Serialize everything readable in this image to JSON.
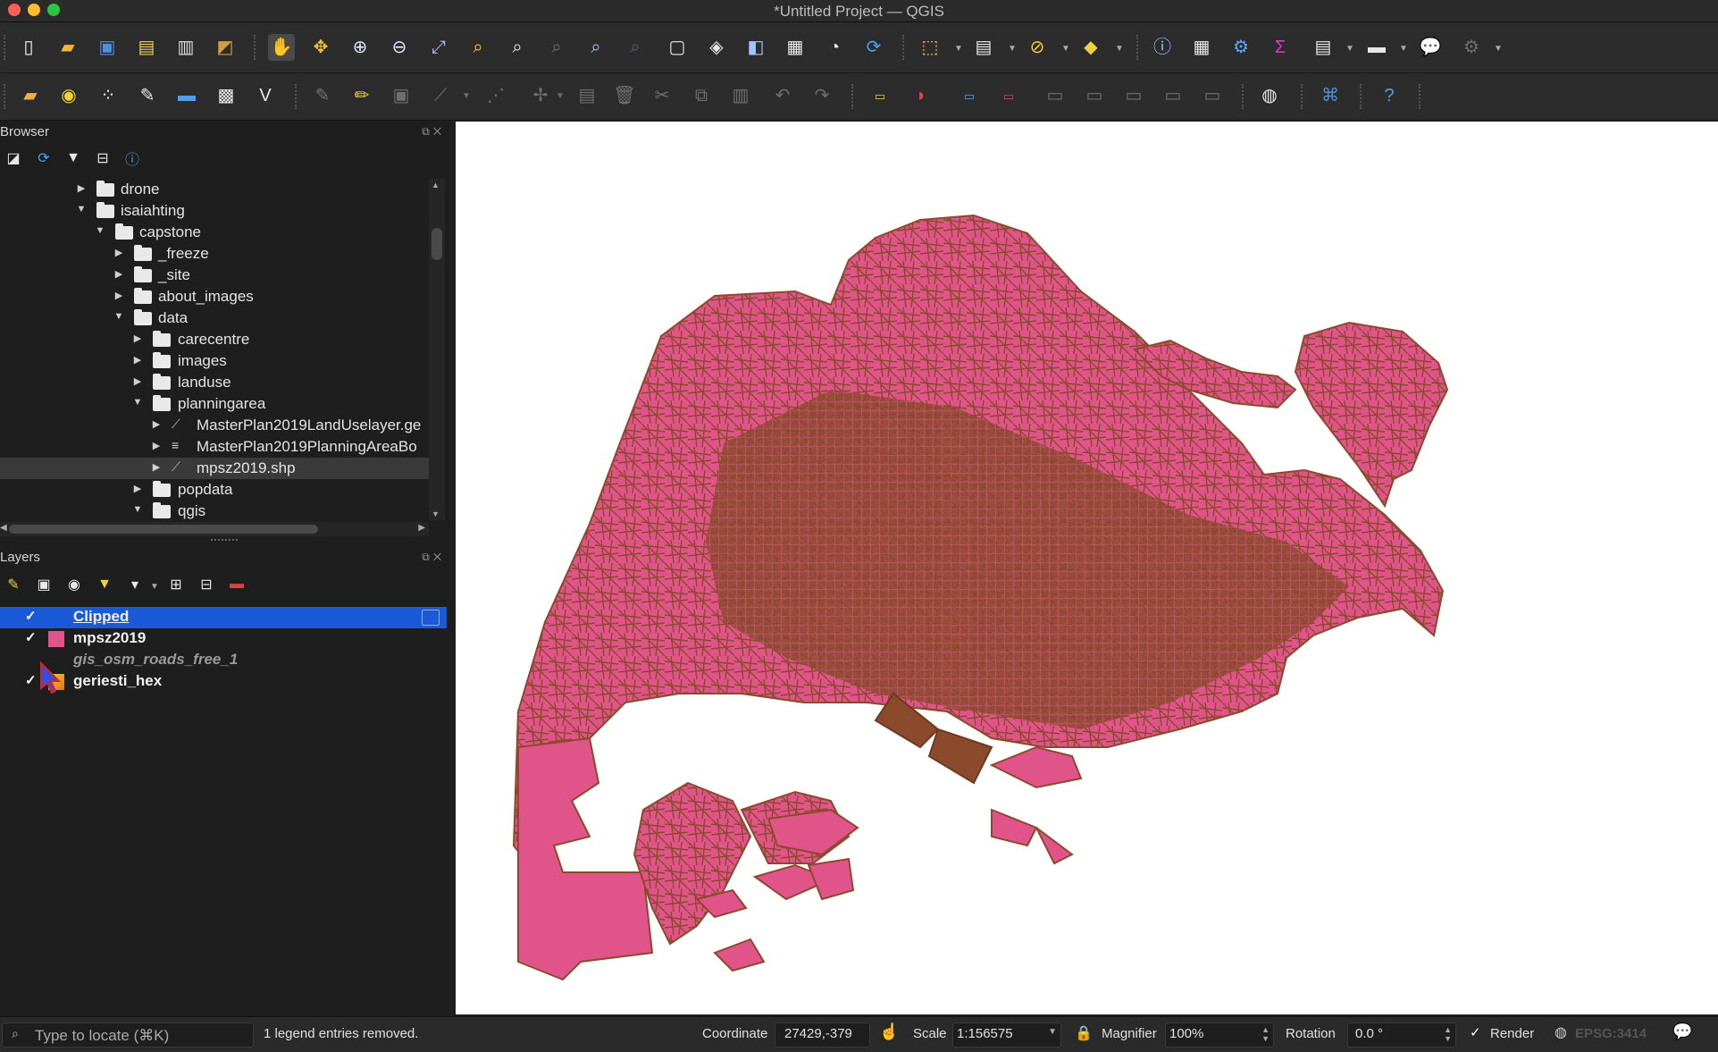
{
  "window": {
    "title": "*Untitled Project — QGIS"
  },
  "toolbar_icons_row1": [
    "new-project",
    "open-project",
    "save-project",
    "new-print-layout",
    "layout-manager",
    "style-manager",
    "pan",
    "pan-to-selection",
    "zoom-in",
    "zoom-out",
    "zoom-full",
    "zoom-to-selection",
    "zoom-to-layer",
    "zoom-native",
    "zoom-last",
    "zoom-next",
    "new-map-view",
    "new-3d-view",
    "new-bookmark",
    "show-bookmarks",
    "temporal-controller",
    "refresh",
    "select-features",
    "select-by-value",
    "deselect",
    "select-by-location",
    "identify",
    "attribute-table",
    "processing",
    "statistics",
    "open-table",
    "measure",
    "map-tips",
    "browse-tools"
  ],
  "toolbar_icons_row2": [
    "data-source-manager",
    "new-geopackage",
    "new-shapefile",
    "digitize",
    "add-layer",
    "add-raster",
    "add-virtual",
    "edits",
    "toggle-editing",
    "save-edits",
    "add-feature",
    "vertex-tool",
    "delete",
    "cut",
    "copy",
    "paste",
    "undo",
    "redo",
    "label-tool",
    "diagram",
    "label-highlight",
    "label-pin",
    "label-show",
    "label-move",
    "label-rotate",
    "label-change",
    "plugins",
    "python",
    "help"
  ],
  "browser": {
    "title": "Browser",
    "items": [
      {
        "label": "drone",
        "expanded": false,
        "icon": "folder"
      },
      {
        "label": "isaiahting",
        "expanded": true,
        "icon": "folder"
      },
      {
        "label": "capstone",
        "expanded": true,
        "icon": "folder"
      },
      {
        "label": "_freeze",
        "expanded": false,
        "icon": "folder"
      },
      {
        "label": "_site",
        "expanded": false,
        "icon": "folder"
      },
      {
        "label": "about_images",
        "expanded": false,
        "icon": "folder"
      },
      {
        "label": "data",
        "expanded": true,
        "icon": "folder"
      },
      {
        "label": "carecentre",
        "expanded": false,
        "icon": "folder"
      },
      {
        "label": "images",
        "expanded": false,
        "icon": "folder"
      },
      {
        "label": "landuse",
        "expanded": false,
        "icon": "folder"
      },
      {
        "label": "planningarea",
        "expanded": true,
        "icon": "folder"
      },
      {
        "label": "MasterPlan2019LandUselayer.ge",
        "expanded": false,
        "icon": "vector-file"
      },
      {
        "label": "MasterPlan2019PlanningAreaBo",
        "expanded": false,
        "icon": "database"
      },
      {
        "label": "mpsz2019.shp",
        "expanded": false,
        "icon": "vector-file"
      },
      {
        "label": "popdata",
        "expanded": false,
        "icon": "folder"
      },
      {
        "label": "qgis",
        "expanded": true,
        "icon": "folder"
      }
    ]
  },
  "layers": {
    "title": "Layers",
    "items": [
      {
        "label": "Clipped",
        "checked": true,
        "active": true
      },
      {
        "label": "mpsz2019",
        "checked": true,
        "active": false,
        "color": "#e0548a"
      },
      {
        "label": "gis_osm_roads_free_1",
        "checked": false,
        "active": false
      },
      {
        "label": "geriesti_hex",
        "checked": true,
        "active": false
      }
    ]
  },
  "status": {
    "locator_placeholder": "Type to locate (⌘K)",
    "message": "1 legend entries removed.",
    "coordinate_label": "Coordinate",
    "coordinate_value": "27429,-379",
    "scale_label": "Scale",
    "scale_value": "1:156575",
    "magnifier_label": "Magnifier",
    "magnifier_value": "100%",
    "rotation_label": "Rotation",
    "rotation_value": "0.0 °",
    "render_label": "Render",
    "render_checked": true,
    "crs": "EPSG:3414"
  },
  "colors": {
    "polygon_fill": "#e0548a",
    "road_stroke": "#8b4a2b",
    "active_layer": "#1a5ad8"
  }
}
